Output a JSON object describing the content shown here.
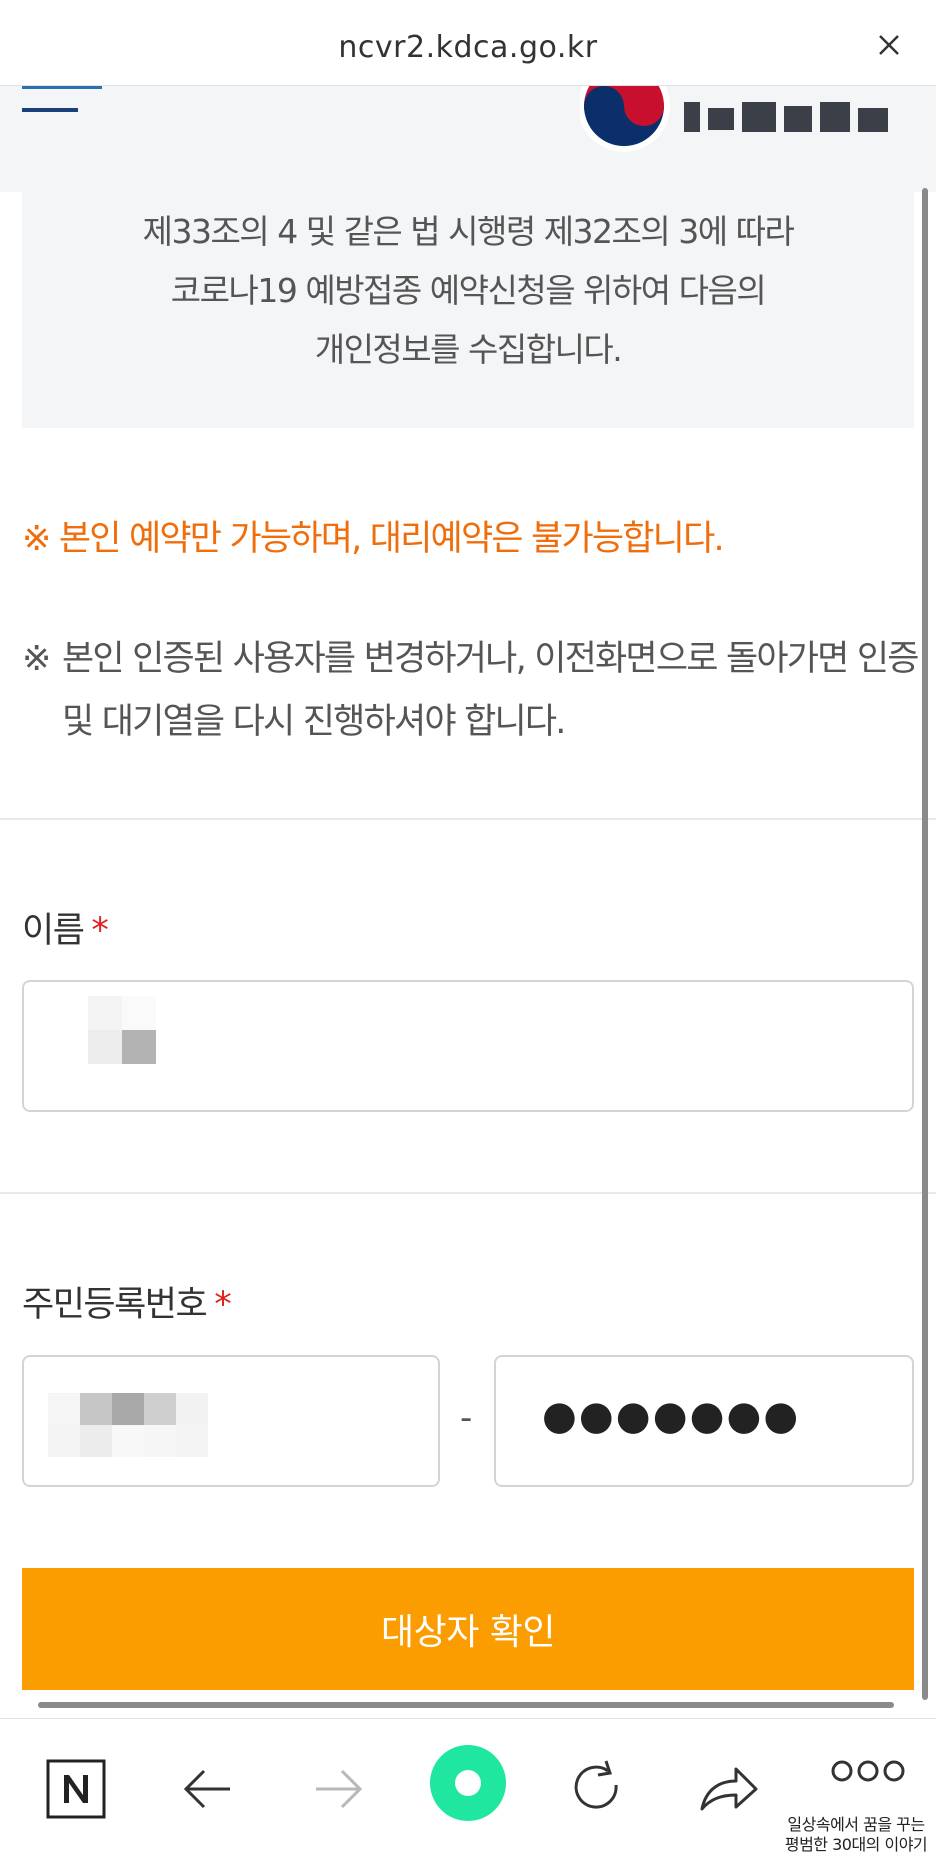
{
  "browser": {
    "url": "ncvr2.kdca.go.kr",
    "close_icon": "close-icon"
  },
  "notice": {
    "line1": "제33조의 4 및 같은 법 시행령 제32조의 3에 따라",
    "line2": "코로나19 예방접종 예약신청을 위하여 다음의",
    "line3": "개인정보를 수집합니다."
  },
  "warnings": {
    "self_only": "※ 본인 예약만 가능하며, 대리예약은 불가능합니다.",
    "symbol": "※",
    "reauth_line1": "본인 인증된 사용자를 변경하거나, 이전화면으로 돌아가면 인증",
    "reauth_line2": "및 대기열을 다시 진행하셔야 합니다."
  },
  "form": {
    "name_label": "이름",
    "id_label": "주민등록번호",
    "required_mark": "*",
    "id_separator": "-",
    "id_back_masked": "●●●●●●●",
    "confirm_button": "대상자 확인"
  },
  "toolbar": {
    "brand_caption_line1": "일상속에서 꿈을 꾸는",
    "brand_caption_line2": "평범한 30대의 이야기"
  },
  "colors": {
    "accent": "#fb9c00",
    "warning": "#f06d0c",
    "required": "#e02020",
    "green_button": "#1fe7a0"
  }
}
